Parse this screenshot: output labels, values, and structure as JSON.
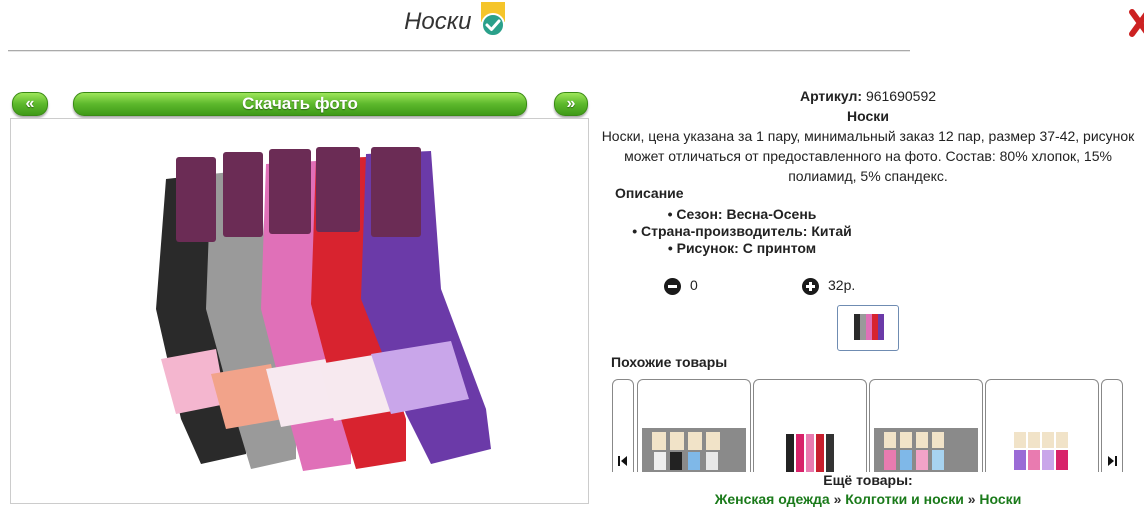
{
  "header": {
    "title": "Носки"
  },
  "gallery": {
    "prev_label": "«",
    "download_label": "Скачать фото",
    "next_label": "»"
  },
  "product": {
    "sku_label": "Артикул:",
    "sku_value": "961690592",
    "name": "Носки",
    "description": "Носки, цена указана за 1 пару, минимальный заказ 12 пар, размер 37-42, рисунок может отличаться от предоставленного на фото. Состав: 80% хлопок, 15% полиамид, 5% спандекс.",
    "desc_heading": "Описание",
    "specs": [
      "Сезон: Весна-Осень",
      "Страна-производитель: Китай",
      "Рисунок: С принтом"
    ],
    "quantity": "0",
    "price": "32р."
  },
  "similar": {
    "title": "Похожие товары"
  },
  "more": {
    "title": "Ещё товары:",
    "crumbs": [
      "Женская одежда",
      "Колготки и носки",
      "Носки"
    ],
    "separator": "»"
  },
  "colors": {
    "green_start": "#9ee65a",
    "green_end": "#3f9a17",
    "link_green": "#1a7a1a",
    "sock_colors": [
      "#2a2a2a",
      "#9a9a9a",
      "#e070b8",
      "#d8232f",
      "#6b3aa8"
    ]
  }
}
